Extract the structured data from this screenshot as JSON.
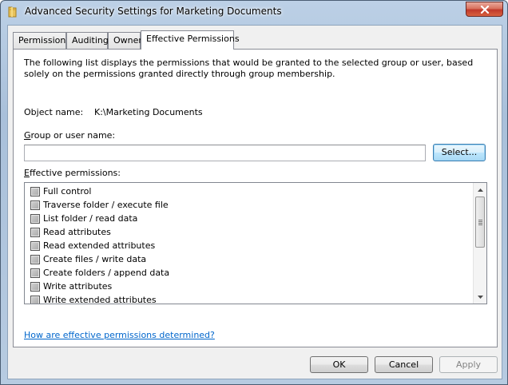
{
  "window": {
    "title": "Advanced Security Settings for Marketing Documents",
    "close_label": "✕"
  },
  "tabs": [
    {
      "label": "Permissions"
    },
    {
      "label": "Auditing"
    },
    {
      "label": "Owner"
    },
    {
      "label": "Effective Permissions",
      "active": true
    }
  ],
  "panel": {
    "description": "The following list displays the permissions that would be granted to the selected group or user, based solely on the permissions granted directly through group membership.",
    "object_name_label": "Object name:",
    "object_name_value": "K:\\Marketing Documents",
    "group_label_accel": "G",
    "group_label_rest": "roup or user name:",
    "group_value": "",
    "select_label": "Select...",
    "effective_label_accel": "E",
    "effective_label_rest": "ffective permissions:",
    "permissions": [
      {
        "label": "Full control",
        "checked": false
      },
      {
        "label": "Traverse folder / execute file",
        "checked": false
      },
      {
        "label": "List folder / read data",
        "checked": false
      },
      {
        "label": "Read attributes",
        "checked": false
      },
      {
        "label": "Read extended attributes",
        "checked": false
      },
      {
        "label": "Create files / write data",
        "checked": false
      },
      {
        "label": "Create folders / append data",
        "checked": false
      },
      {
        "label": "Write attributes",
        "checked": false
      },
      {
        "label": "Write extended attributes",
        "checked": false
      }
    ],
    "help_link": "How are effective permissions determined?"
  },
  "buttons": {
    "ok": "OK",
    "cancel": "Cancel",
    "apply": "Apply"
  }
}
